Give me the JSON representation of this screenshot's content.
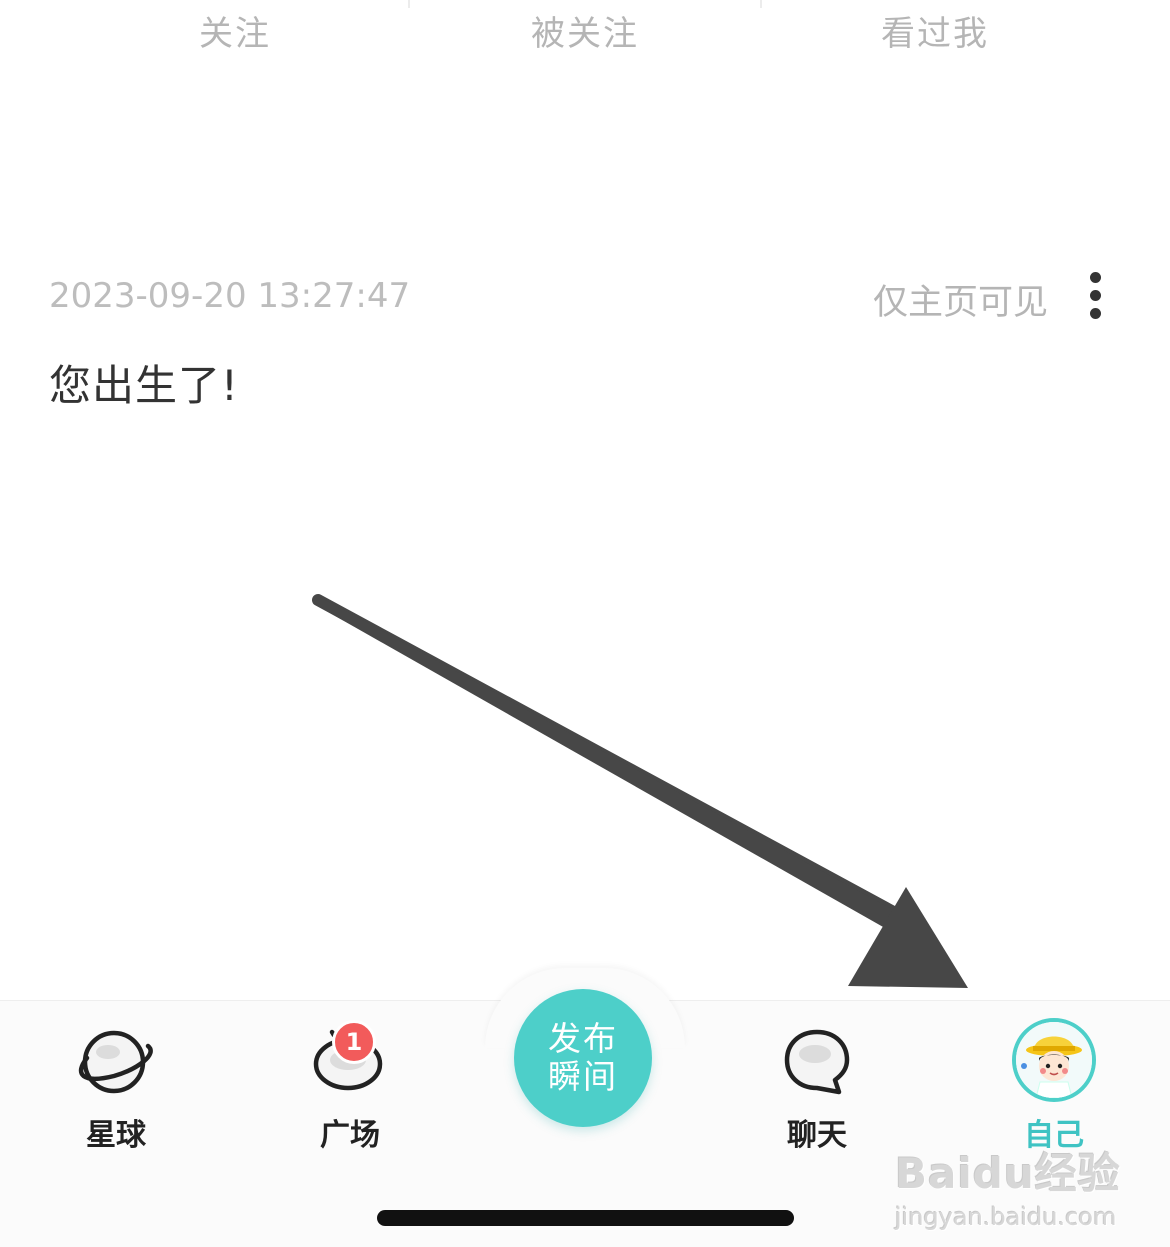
{
  "top_tabs": [
    {
      "label": "关注"
    },
    {
      "label": "被关注"
    },
    {
      "label": "看过我"
    }
  ],
  "post": {
    "timestamp": "2023-09-20 13:27:47",
    "visibility": "仅主页可见",
    "content": "您出生了!"
  },
  "bottom_nav": {
    "items": [
      {
        "label": "星球",
        "icon": "planet-icon"
      },
      {
        "label": "广场",
        "icon": "square-icon",
        "badge": "1"
      },
      {
        "label": "聊天",
        "icon": "chat-bubble-icon"
      },
      {
        "label": "自己",
        "icon": "avatar",
        "active": true
      }
    ],
    "publish": {
      "line1": "发布",
      "line2": "瞬间"
    }
  },
  "watermark": {
    "brand": "Baidu经验",
    "url": "jingyan.baidu.com"
  },
  "colors": {
    "accent": "#4dcfc9",
    "accent_text": "#3fc3c3",
    "badge": "#f25b5b",
    "muted_text": "#b5b5b5",
    "body_text": "#333333"
  }
}
